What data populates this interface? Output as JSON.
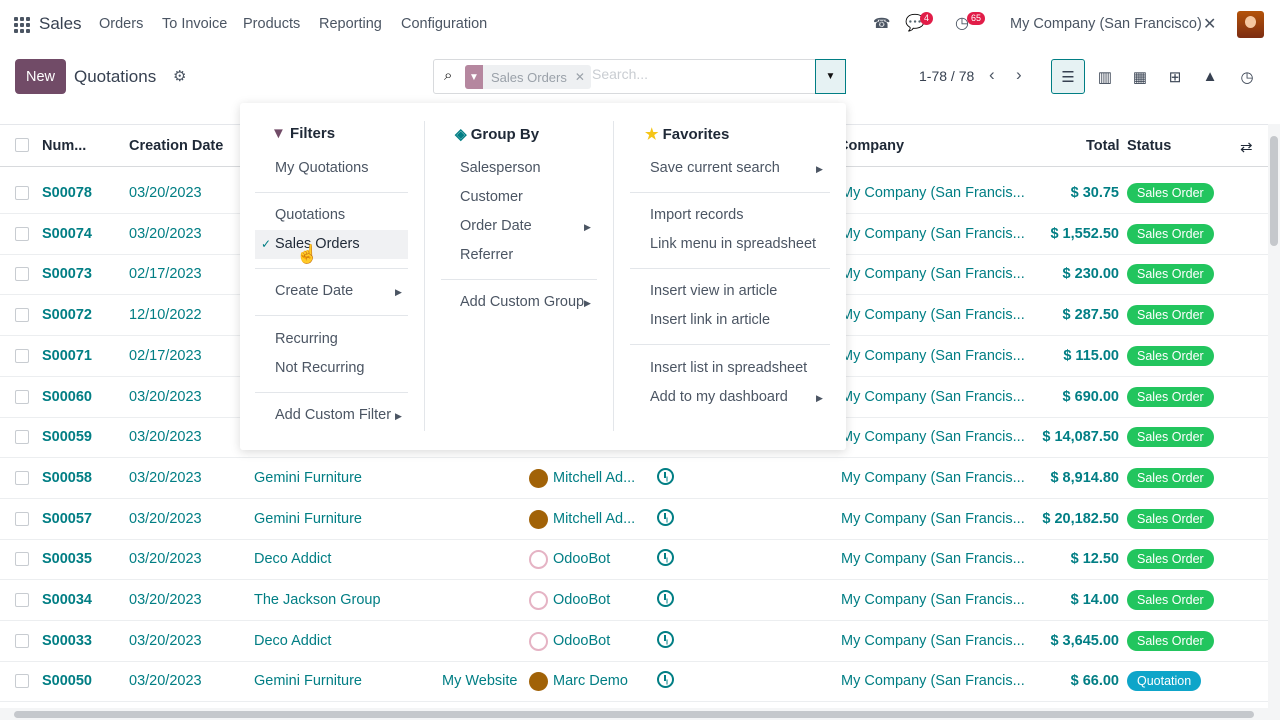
{
  "topbar": {
    "app": "Sales",
    "menu": [
      "Orders",
      "To Invoice",
      "Products",
      "Reporting",
      "Configuration"
    ],
    "messages_count": "4",
    "activities_count": "65",
    "company": "My Company (San Francisco)"
  },
  "control": {
    "new_label": "New",
    "title": "Quotations",
    "facet": "Sales Orders",
    "search_placeholder": "Search...",
    "pager": "1-78 / 78"
  },
  "columns": {
    "number": "Num...",
    "creation_date": "Creation Date",
    "company": "Company",
    "total": "Total",
    "status": "Status"
  },
  "rows": [
    {
      "number": "S00078",
      "date": "03/20/2023",
      "customer": "",
      "website": "",
      "salesperson": "",
      "company": "My Company (San Francis...",
      "total": "$ 30.75",
      "status": "Sales Order"
    },
    {
      "number": "S00074",
      "date": "03/20/2023",
      "customer": "",
      "website": "",
      "salesperson": "",
      "company": "My Company (San Francis...",
      "total": "$ 1,552.50",
      "status": "Sales Order"
    },
    {
      "number": "S00073",
      "date": "02/17/2023",
      "customer": "",
      "website": "",
      "salesperson": "",
      "company": "My Company (San Francis...",
      "total": "$ 230.00",
      "status": "Sales Order"
    },
    {
      "number": "S00072",
      "date": "12/10/2022",
      "customer": "",
      "website": "",
      "salesperson": "",
      "company": "My Company (San Francis...",
      "total": "$ 287.50",
      "status": "Sales Order"
    },
    {
      "number": "S00071",
      "date": "02/17/2023",
      "customer": "",
      "website": "",
      "salesperson": "",
      "company": "My Company (San Francis...",
      "total": "$ 115.00",
      "status": "Sales Order"
    },
    {
      "number": "S00060",
      "date": "03/20/2023",
      "customer": "",
      "website": "",
      "salesperson": "",
      "company": "My Company (San Francis...",
      "total": "$ 690.00",
      "status": "Sales Order"
    },
    {
      "number": "S00059",
      "date": "03/20/2023",
      "customer": "",
      "website": "",
      "salesperson": "",
      "company": "My Company (San Francis...",
      "total": "$ 14,087.50",
      "status": "Sales Order"
    },
    {
      "number": "S00058",
      "date": "03/20/2023",
      "customer": "Gemini Furniture",
      "website": "",
      "salesperson": "Mitchell Ad...",
      "company": "My Company (San Francis...",
      "total": "$ 8,914.80",
      "status": "Sales Order"
    },
    {
      "number": "S00057",
      "date": "03/20/2023",
      "customer": "Gemini Furniture",
      "website": "",
      "salesperson": "Mitchell Ad...",
      "company": "My Company (San Francis...",
      "total": "$ 20,182.50",
      "status": "Sales Order"
    },
    {
      "number": "S00035",
      "date": "03/20/2023",
      "customer": "Deco Addict",
      "website": "",
      "salesperson": "OdooBot",
      "company": "My Company (San Francis...",
      "total": "$ 12.50",
      "status": "Sales Order"
    },
    {
      "number": "S00034",
      "date": "03/20/2023",
      "customer": "The Jackson Group",
      "website": "",
      "salesperson": "OdooBot",
      "company": "My Company (San Francis...",
      "total": "$ 14.00",
      "status": "Sales Order"
    },
    {
      "number": "S00033",
      "date": "03/20/2023",
      "customer": "Deco Addict",
      "website": "",
      "salesperson": "OdooBot",
      "company": "My Company (San Francis...",
      "total": "$ 3,645.00",
      "status": "Sales Order"
    },
    {
      "number": "S00050",
      "date": "03/20/2023",
      "customer": "Gemini Furniture",
      "website": "My Website",
      "salesperson": "Marc Demo",
      "company": "My Company (San Francis...",
      "total": "$ 66.00",
      "status": "Quotation"
    }
  ],
  "dropdown": {
    "filters": {
      "title": "Filters",
      "items": [
        "My Quotations",
        "Quotations",
        "Sales Orders",
        "Create Date",
        "Recurring",
        "Not Recurring",
        "Add Custom Filter"
      ]
    },
    "group_by": {
      "title": "Group By",
      "items": [
        "Salesperson",
        "Customer",
        "Order Date",
        "Referrer",
        "Add Custom Group"
      ]
    },
    "favorites": {
      "title": "Favorites",
      "items": [
        "Save current search",
        "Import records",
        "Link menu in spreadsheet",
        "Insert view in article",
        "Insert link in article",
        "Insert list in spreadsheet",
        "Add to my dashboard"
      ]
    }
  },
  "colors": {
    "brand": "#714b67",
    "accent": "#017e84",
    "sales_order": "#22c55e",
    "quotation": "#0ea5c9"
  }
}
